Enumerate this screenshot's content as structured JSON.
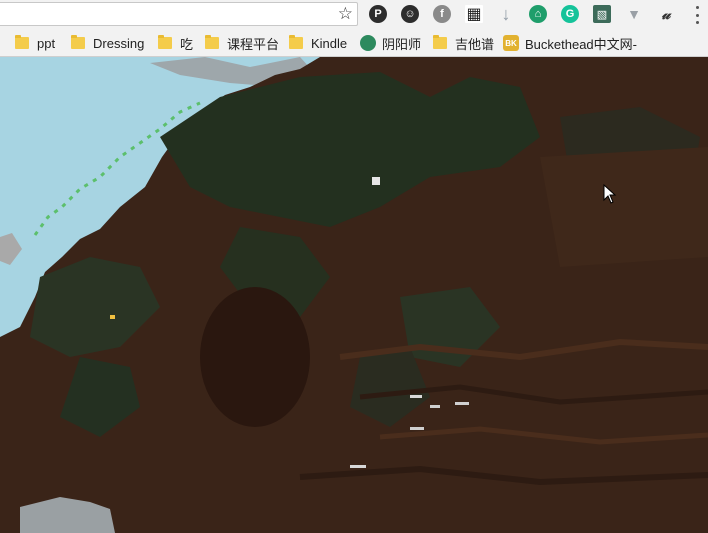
{
  "toolbar": {
    "extensions": [
      {
        "name": "pinterest-icon",
        "glyph": "P",
        "color": "#2d2d2d"
      },
      {
        "name": "pirate-mask-icon",
        "glyph": "☺",
        "color": "#2d2d2d"
      },
      {
        "name": "feedly-icon",
        "glyph": "f",
        "color": "#8a8a8a"
      },
      {
        "name": "qr-code-icon",
        "glyph": "▦",
        "color": "#333333"
      },
      {
        "name": "download-arrow-icon",
        "glyph": "↓",
        "color": "#8f9aa5"
      },
      {
        "name": "museum-icon",
        "glyph": "⌂",
        "color": "#1f9e6b"
      },
      {
        "name": "grammarly-icon",
        "glyph": "G",
        "color": "#15c39a"
      },
      {
        "name": "image-capture-icon",
        "glyph": "▧",
        "color": "#3d6b5a"
      },
      {
        "name": "vee-icon",
        "glyph": "▼",
        "color": "#9aa0a6"
      },
      {
        "name": "signature-icon",
        "glyph": "𝓊",
        "color": "#333333"
      }
    ]
  },
  "bookmarks": [
    {
      "label": "ppt",
      "type": "folder"
    },
    {
      "label": "Dressing",
      "type": "folder"
    },
    {
      "label": "吃",
      "type": "folder"
    },
    {
      "label": "课程平台",
      "type": "folder"
    },
    {
      "label": "Kindle",
      "type": "folder"
    },
    {
      "label": "阴阳师",
      "type": "site",
      "icon_text": "",
      "icon_color": "#2d8a5e"
    },
    {
      "label": "吉他谱",
      "type": "folder"
    },
    {
      "label": "Buckethead中文网-",
      "type": "site",
      "icon_text": "BK",
      "icon_color": "#e2b230"
    }
  ],
  "colors": {
    "sky": "#a7d4e2",
    "cliff": "#3a2418",
    "foliage": "#23301f"
  }
}
